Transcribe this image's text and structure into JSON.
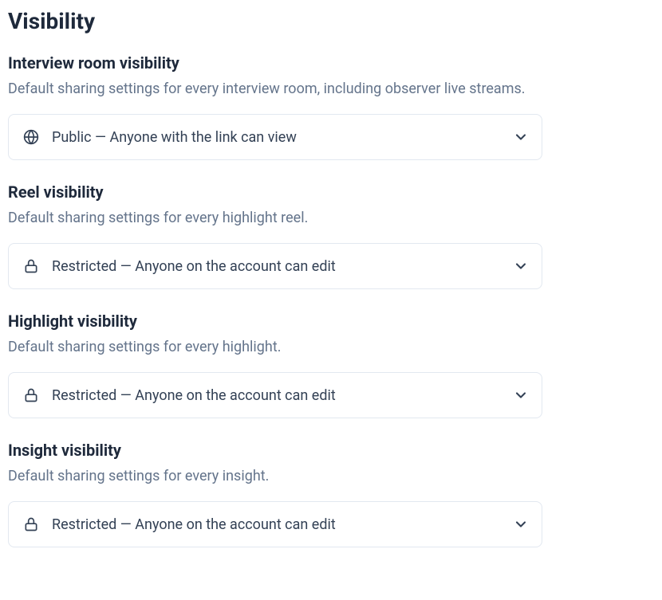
{
  "page_title": "Visibility",
  "sections": {
    "interview_room": {
      "title": "Interview room visibility",
      "description": "Default sharing settings for every interview room, including observer live streams.",
      "selected_label": "Public — Anyone with the link can view",
      "icon": "globe"
    },
    "reel": {
      "title": "Reel visibility",
      "description": "Default sharing settings for every highlight reel.",
      "selected_label": "Restricted — Anyone on the account can edit",
      "icon": "lock"
    },
    "highlight": {
      "title": "Highlight visibility",
      "description": "Default sharing settings for every highlight.",
      "selected_label": "Restricted — Anyone on the account can edit",
      "icon": "lock"
    },
    "insight": {
      "title": "Insight visibility",
      "description": "Default sharing settings for every insight.",
      "selected_label": "Restricted — Anyone on the account can edit",
      "icon": "lock"
    }
  }
}
